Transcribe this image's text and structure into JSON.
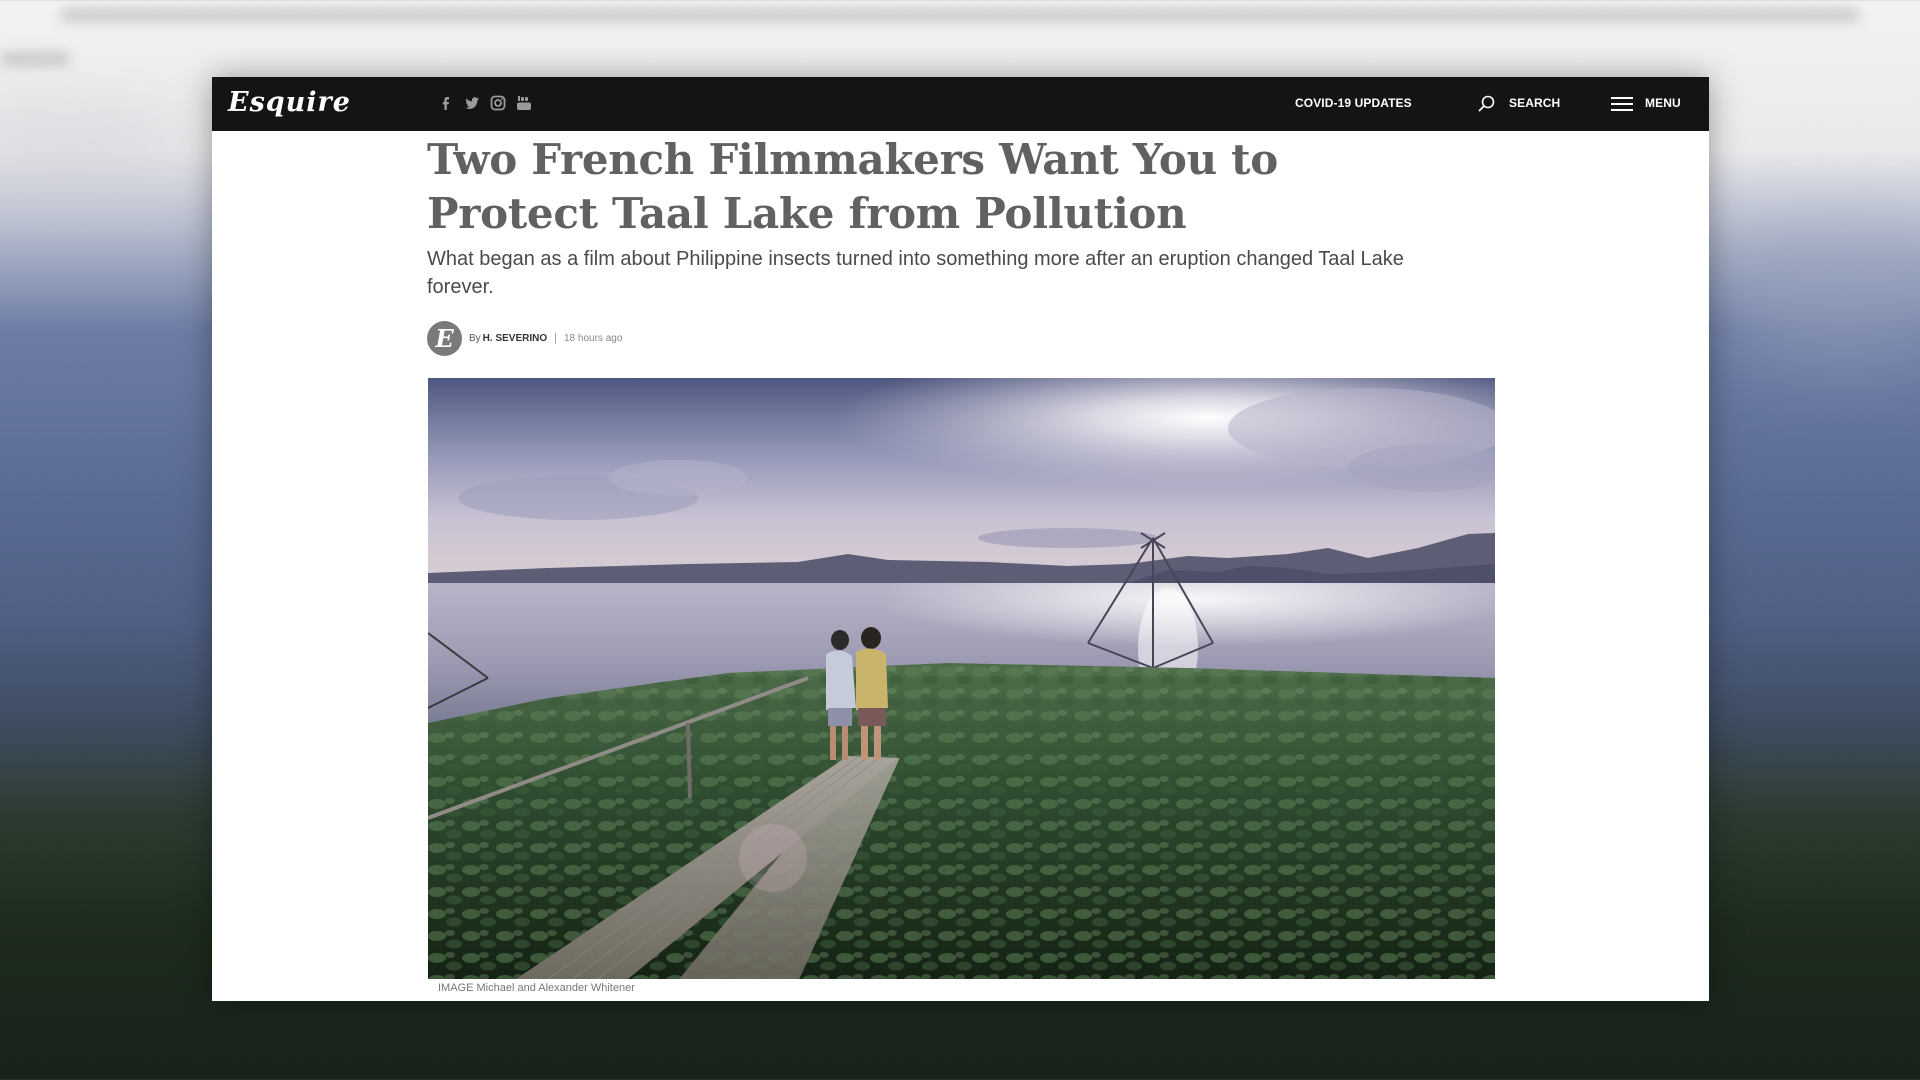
{
  "nav": {
    "logo": "Esquire",
    "social_icons": [
      "facebook-icon",
      "twitter-icon",
      "instagram-icon",
      "youtube-icon"
    ],
    "covid_label": "COVID-19 UPDATES",
    "search_label": "SEARCH",
    "menu_label": "MENU"
  },
  "article": {
    "headline": "Two French Filmmakers Want You to Protect Taal Lake from Pollution",
    "dek": "What began as a film about Philippine insects turned into something more after an eruption changed Taal Lake forever.",
    "byline": {
      "prefix": "By",
      "author": "H. SEVERINO",
      "separator": "|",
      "timestamp": "18 hours ago",
      "avatar_letter": "E"
    },
    "hero_image": {
      "caption": "IMAGE Michael and Alexander Whitener"
    }
  },
  "colors": {
    "navbar_bg": "#141414",
    "headline": "#616161",
    "dek": "#4a4a4a",
    "page_bg": "#ffffff"
  }
}
